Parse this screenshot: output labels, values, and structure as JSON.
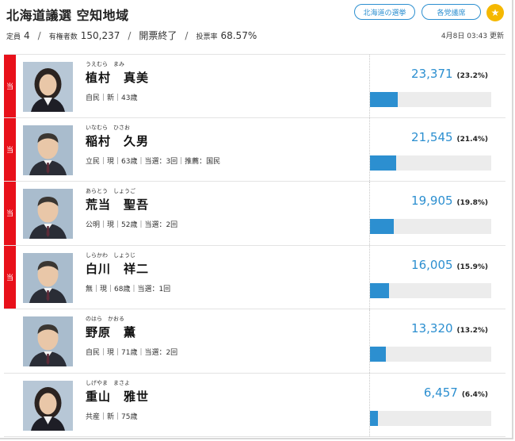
{
  "header": {
    "title": "北海道議選 空知地域",
    "btn_hokkaido": "北海道の選挙",
    "btn_parties": "各党議席",
    "star_icon": "star-icon"
  },
  "stats": {
    "seats_label": "定員",
    "seats_value": "4",
    "sep": "/",
    "voters_label": "有権者数",
    "voters_value": "150,237",
    "count_status": "開票終了",
    "turnout_label": "投票率",
    "turnout_value": "68.57%",
    "updated": "4月8日 03:43 更新"
  },
  "candidates": [
    {
      "elected": true,
      "elected_label": "当",
      "reading": "うえむら　まみ",
      "name": "植村　真美",
      "info": "自民｜新｜43歳",
      "votes": "23,371",
      "pct": "(23.2%)",
      "share": 23.2,
      "gender": "f"
    },
    {
      "elected": true,
      "elected_label": "当",
      "reading": "いなむら　ひさお",
      "name": "稲村　久男",
      "info": "立民｜現｜63歳｜当選：3回｜推薦：国民",
      "votes": "21,545",
      "pct": "(21.4%)",
      "share": 21.4,
      "gender": "m"
    },
    {
      "elected": true,
      "elected_label": "当",
      "reading": "あらとう　しょうご",
      "name": "荒当　聖吾",
      "info": "公明｜現｜52歳｜当選：2回",
      "votes": "19,905",
      "pct": "(19.8%)",
      "share": 19.8,
      "gender": "m"
    },
    {
      "elected": true,
      "elected_label": "当",
      "reading": "しらかわ　しょうじ",
      "name": "白川　祥二",
      "info": "無｜現｜68歳｜当選：1回",
      "votes": "16,005",
      "pct": "(15.9%)",
      "share": 15.9,
      "gender": "m"
    },
    {
      "elected": false,
      "elected_label": "",
      "reading": "のはら　かおる",
      "name": "野原　薫",
      "info": "自民｜現｜71歳｜当選：2回",
      "votes": "13,320",
      "pct": "(13.2%)",
      "share": 13.2,
      "gender": "m"
    },
    {
      "elected": false,
      "elected_label": "",
      "reading": "しげやま　まさよ",
      "name": "重山　雅世",
      "info": "共産｜新｜75歳",
      "votes": "6,457",
      "pct": "(6.4%)",
      "share": 6.4,
      "gender": "f"
    }
  ],
  "colors": {
    "accent": "#2c8fd0",
    "elected": "#e8101a",
    "star": "#f5b800"
  }
}
